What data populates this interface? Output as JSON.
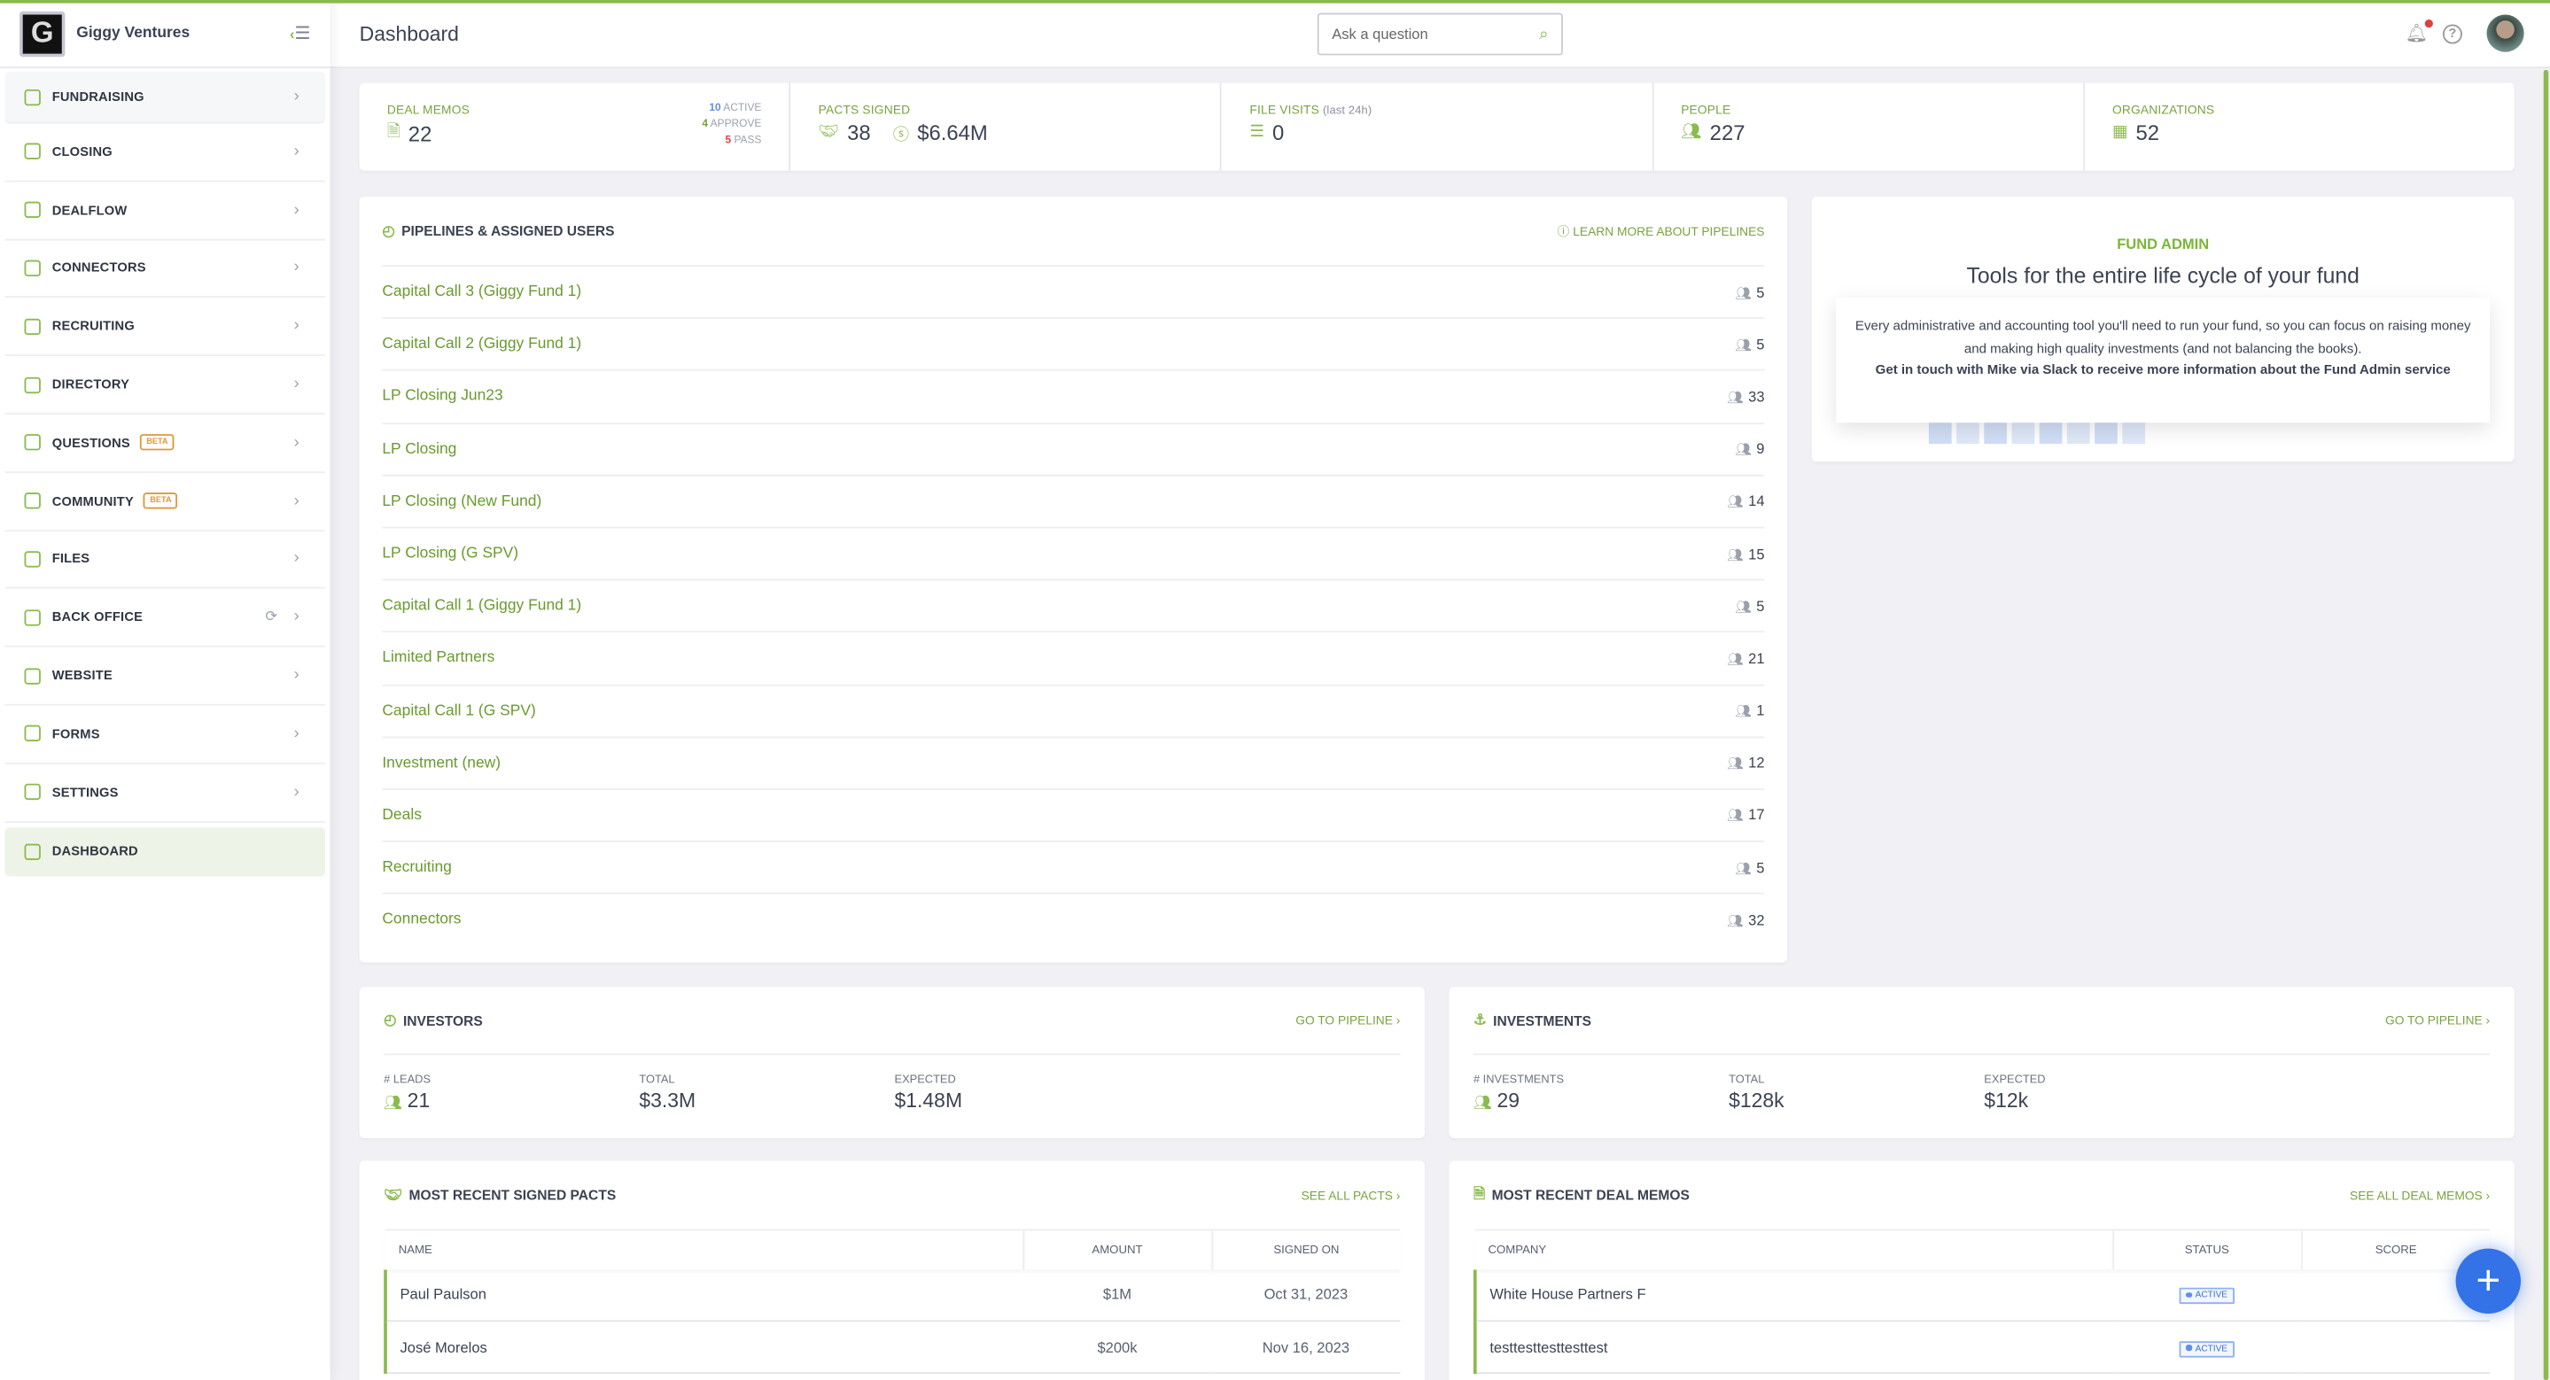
{
  "brand": {
    "name": "Giggy Ventures",
    "logo_letter": "G"
  },
  "header": {
    "title": "Dashboard",
    "search_placeholder": "Ask a question"
  },
  "sidebar": {
    "items": [
      {
        "label": "FUNDRAISING"
      },
      {
        "label": "CLOSING"
      },
      {
        "label": "DEALFLOW"
      },
      {
        "label": "CONNECTORS"
      },
      {
        "label": "RECRUITING"
      },
      {
        "label": "DIRECTORY"
      },
      {
        "label": "QUESTIONS",
        "badge": "BETA"
      },
      {
        "label": "COMMUNITY",
        "badge": "BETA"
      },
      {
        "label": "FILES"
      },
      {
        "label": "BACK OFFICE"
      },
      {
        "label": "WEBSITE"
      },
      {
        "label": "FORMS"
      },
      {
        "label": "SETTINGS"
      },
      {
        "label": "DASHBOARD",
        "active": true
      }
    ]
  },
  "stats": {
    "deal_memos": {
      "label": "DEAL MEMOS",
      "value": "22",
      "active": "10",
      "active_label": "ACTIVE",
      "approve": "4",
      "approve_label": "APPROVE",
      "pass": "5",
      "pass_label": "PASS"
    },
    "pacts": {
      "label": "PACTS SIGNED",
      "count": "38",
      "amount": "$6.64M"
    },
    "file_visits": {
      "label": "FILE VISITS",
      "sub": "(last 24h)",
      "value": "0"
    },
    "people": {
      "label": "PEOPLE",
      "value": "227"
    },
    "organizations": {
      "label": "ORGANIZATIONS",
      "value": "52"
    }
  },
  "pipelines": {
    "title": "PIPELINES & ASSIGNED USERS",
    "link": "LEARN MORE ABOUT PIPELINES",
    "rows": [
      {
        "name": "Capital Call 3 (Giggy Fund 1)",
        "users": "5"
      },
      {
        "name": "Capital Call 2 (Giggy Fund 1)",
        "users": "5"
      },
      {
        "name": "LP Closing Jun23",
        "users": "33"
      },
      {
        "name": "LP Closing",
        "users": "9"
      },
      {
        "name": "LP Closing (New Fund)",
        "users": "14"
      },
      {
        "name": "LP Closing (G SPV)",
        "users": "15"
      },
      {
        "name": "Capital Call 1 (Giggy Fund 1)",
        "users": "5"
      },
      {
        "name": "Limited Partners",
        "users": "21"
      },
      {
        "name": "Capital Call 1 (G SPV)",
        "users": "1"
      },
      {
        "name": "Investment (new)",
        "users": "12"
      },
      {
        "name": "Deals",
        "users": "17"
      },
      {
        "name": "Recruiting",
        "users": "5"
      },
      {
        "name": "Connectors",
        "users": "32"
      }
    ]
  },
  "fund_admin": {
    "kicker": "FUND ADMIN",
    "title": "Tools for the entire life cycle of your fund",
    "body": "Every administrative and accounting tool you'll need to run your fund, so you can focus on raising money and making high quality investments (and not balancing the books).",
    "cta": "Get in touch with Mike via Slack to receive more information about the Fund Admin service"
  },
  "investors": {
    "title": "INVESTORS",
    "link": "GO TO PIPELINE",
    "leads_label": "# LEADS",
    "leads": "21",
    "total_label": "TOTAL",
    "total": "$3.3M",
    "expected_label": "EXPECTED",
    "expected": "$1.48M"
  },
  "investments": {
    "title": "INVESTMENTS",
    "link": "GO TO PIPELINE",
    "count_label": "# INVESTMENTS",
    "count": "29",
    "total_label": "TOTAL",
    "total": "$128k",
    "expected_label": "EXPECTED",
    "expected": "$12k"
  },
  "pacts_table": {
    "title": "MOST RECENT SIGNED PACTS",
    "link": "SEE ALL PACTS",
    "columns": [
      "NAME",
      "AMOUNT",
      "SIGNED ON"
    ],
    "rows": [
      {
        "name": "Paul Paulson",
        "amount": "$1M",
        "date": "Oct 31, 2023"
      },
      {
        "name": "José Morelos",
        "amount": "$200k",
        "date": "Nov 16, 2023"
      }
    ]
  },
  "memos_table": {
    "title": "MOST RECENT DEAL MEMOS",
    "link": "SEE ALL DEAL MEMOS",
    "columns": [
      "COMPANY",
      "STATUS",
      "SCORE"
    ],
    "rows": [
      {
        "company": "White House Partners F",
        "status": "ACTIVE",
        "score": ""
      },
      {
        "company": "testtesttesttesttest",
        "status": "ACTIVE",
        "score": ""
      }
    ]
  },
  "colors": {
    "accent": "#8bba4f",
    "link": "#79a23f",
    "fab": "#3472e8",
    "active_badge": "#3b6fd6",
    "pass": "#e04040",
    "active": "#5f8fe6"
  }
}
